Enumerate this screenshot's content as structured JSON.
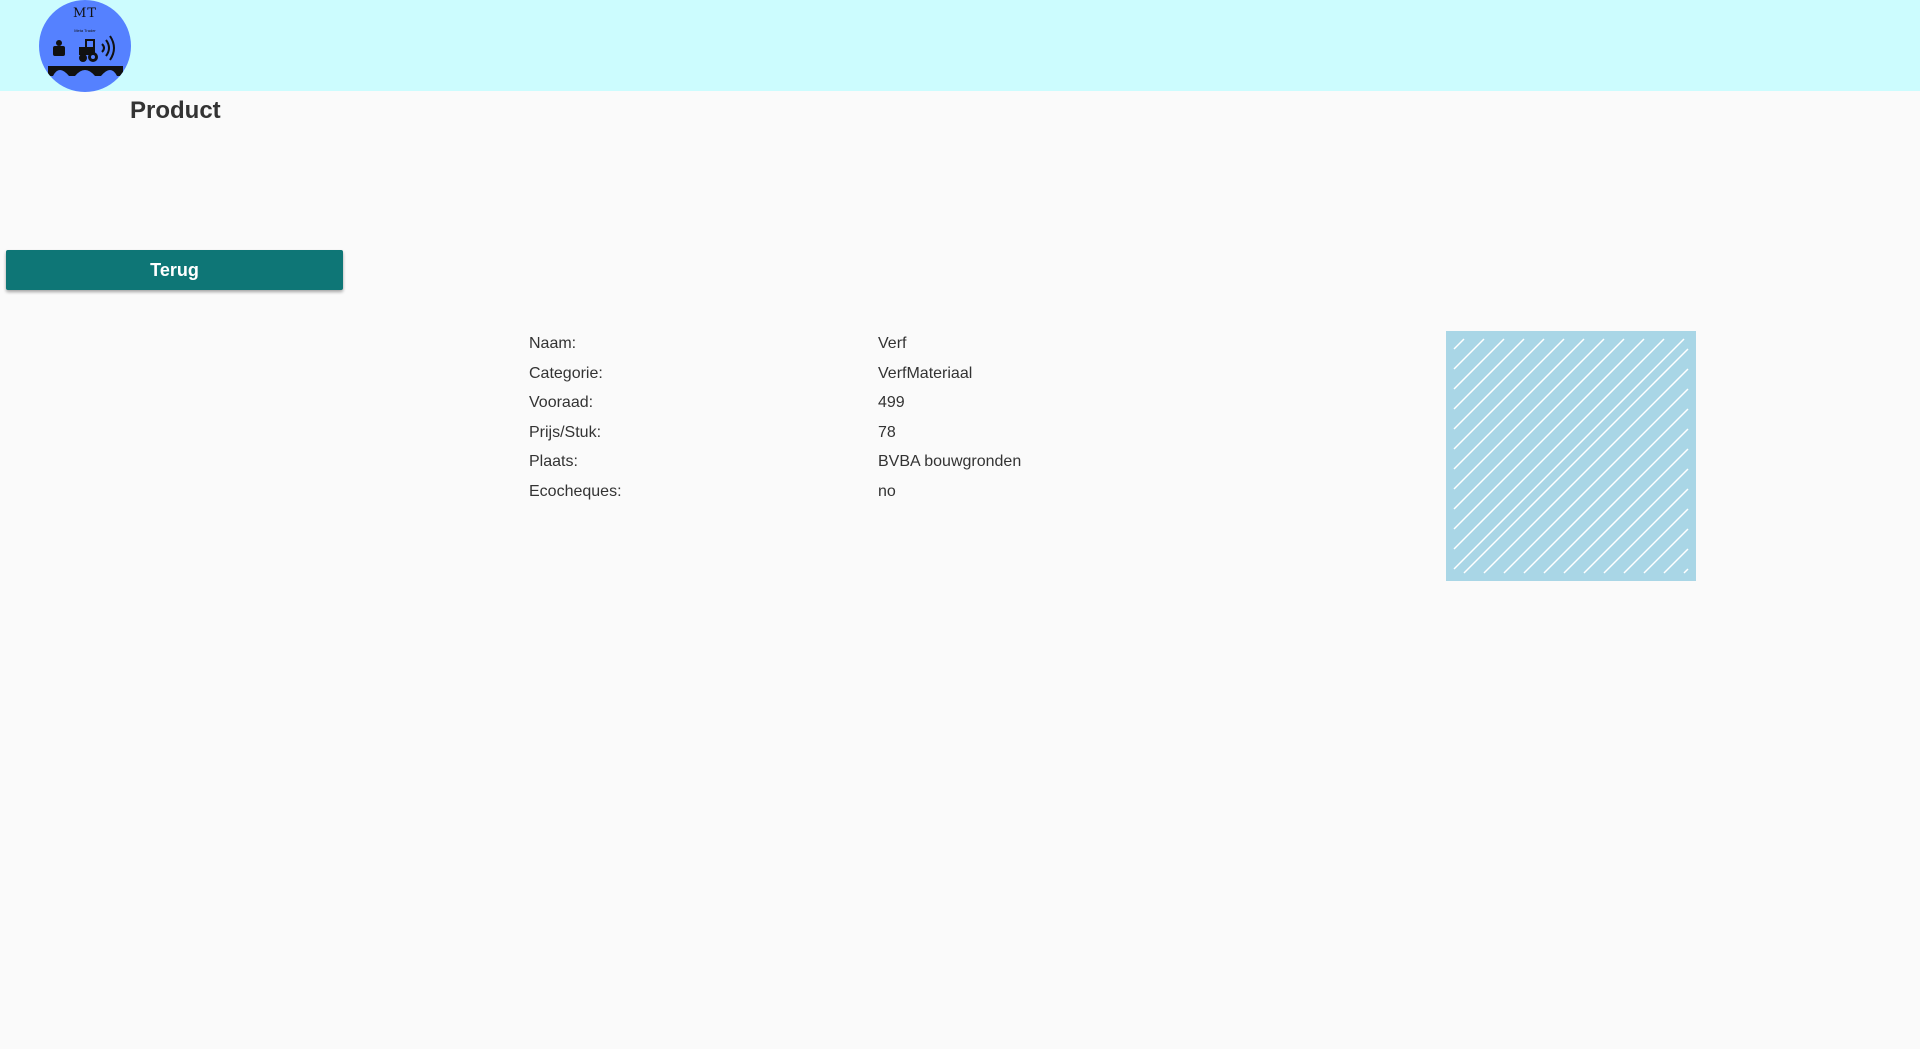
{
  "header": {
    "logo": {
      "text": "MT",
      "subtext": "Meta Trader",
      "icon": "tractor-bridge-logo"
    }
  },
  "page": {
    "title": "Product"
  },
  "actions": {
    "back_label": "Terug"
  },
  "product": {
    "fields": [
      {
        "label": "Naam:",
        "value": "Verf"
      },
      {
        "label": "Categorie:",
        "value": "VerfMateriaal"
      },
      {
        "label": "Vooraad:",
        "value": "499"
      },
      {
        "label": "Prijs/Stuk:",
        "value": "78"
      },
      {
        "label": "Plaats:",
        "value": "BVBA bouwgronden"
      },
      {
        "label": "Ecocheques:",
        "value": "no"
      }
    ],
    "image_placeholder_icon": "image-placeholder-icon"
  },
  "colors": {
    "header_bg": "#ccfcfe",
    "page_bg": "#fafafa",
    "button_bg": "#0e7676",
    "logo_bg": "#5581ff",
    "image_placeholder_bg": "#a9d6e6"
  }
}
